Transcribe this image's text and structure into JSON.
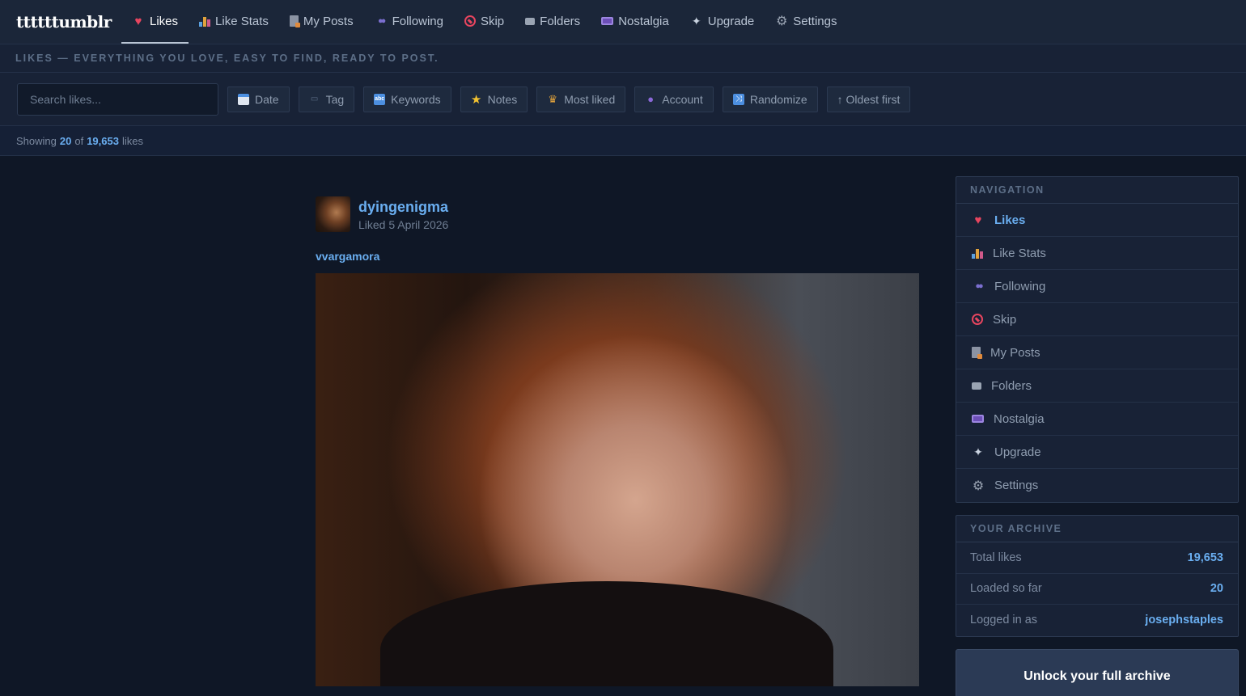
{
  "app": {
    "brand": "ttttttumblr"
  },
  "topnav": {
    "items": [
      {
        "label": "Likes",
        "icon": "heart-icon",
        "active": true
      },
      {
        "label": "Like Stats",
        "icon": "bar-chart-icon"
      },
      {
        "label": "My Posts",
        "icon": "document-icon"
      },
      {
        "label": "Following",
        "icon": "people-icon"
      },
      {
        "label": "Skip",
        "icon": "no-entry-icon"
      },
      {
        "label": "Folders",
        "icon": "folder-icon"
      },
      {
        "label": "Nostalgia",
        "icon": "tv-icon"
      },
      {
        "label": "Upgrade",
        "icon": "sparkle-icon"
      },
      {
        "label": "Settings",
        "icon": "gear-icon"
      }
    ]
  },
  "tagline": "LIKES — EVERYTHING YOU LOVE, EASY TO FIND, READY TO POST.",
  "toolbar": {
    "search_placeholder": "Search likes...",
    "buttons": [
      {
        "label": "Date",
        "icon": "calendar-icon"
      },
      {
        "label": "Tag",
        "icon": "tag-icon"
      },
      {
        "label": "Keywords",
        "icon": "abc-icon"
      },
      {
        "label": "Notes",
        "icon": "star-icon"
      },
      {
        "label": "Most liked",
        "icon": "trophy-icon"
      },
      {
        "label": "Account",
        "icon": "user-icon"
      },
      {
        "label": "Randomize",
        "icon": "shuffle-icon"
      },
      {
        "label": "↑ Oldest first",
        "icon": ""
      }
    ]
  },
  "status": {
    "prefix": "Showing",
    "shown": "20",
    "of": "of",
    "total": "19,653",
    "suffix": "likes"
  },
  "post": {
    "blog": "dyingenigma",
    "liked": "Liked 5 April 2026",
    "reblog_from": "vvargamora"
  },
  "sidebar": {
    "nav_title": "NAVIGATION",
    "nav": [
      {
        "label": "Likes",
        "icon": "heart-icon",
        "active": true
      },
      {
        "label": "Like Stats",
        "icon": "bar-chart-icon"
      },
      {
        "label": "Following",
        "icon": "people-icon"
      },
      {
        "label": "Skip",
        "icon": "no-entry-icon"
      },
      {
        "label": "My Posts",
        "icon": "document-icon"
      },
      {
        "label": "Folders",
        "icon": "folder-icon"
      },
      {
        "label": "Nostalgia",
        "icon": "tv-icon"
      },
      {
        "label": "Upgrade",
        "icon": "sparkle-icon"
      },
      {
        "label": "Settings",
        "icon": "gear-icon"
      }
    ],
    "archive_title": "YOUR ARCHIVE",
    "archive": [
      {
        "label": "Total likes",
        "value": "19,653"
      },
      {
        "label": "Loaded so far",
        "value": "20"
      },
      {
        "label": "Logged in as",
        "value": "josephstaples"
      }
    ],
    "unlock_title": "Unlock your full archive"
  },
  "colors": {
    "accent": "#6aaef0",
    "background": "#0f1726",
    "panel": "#182236",
    "heart": "#e8455f"
  }
}
